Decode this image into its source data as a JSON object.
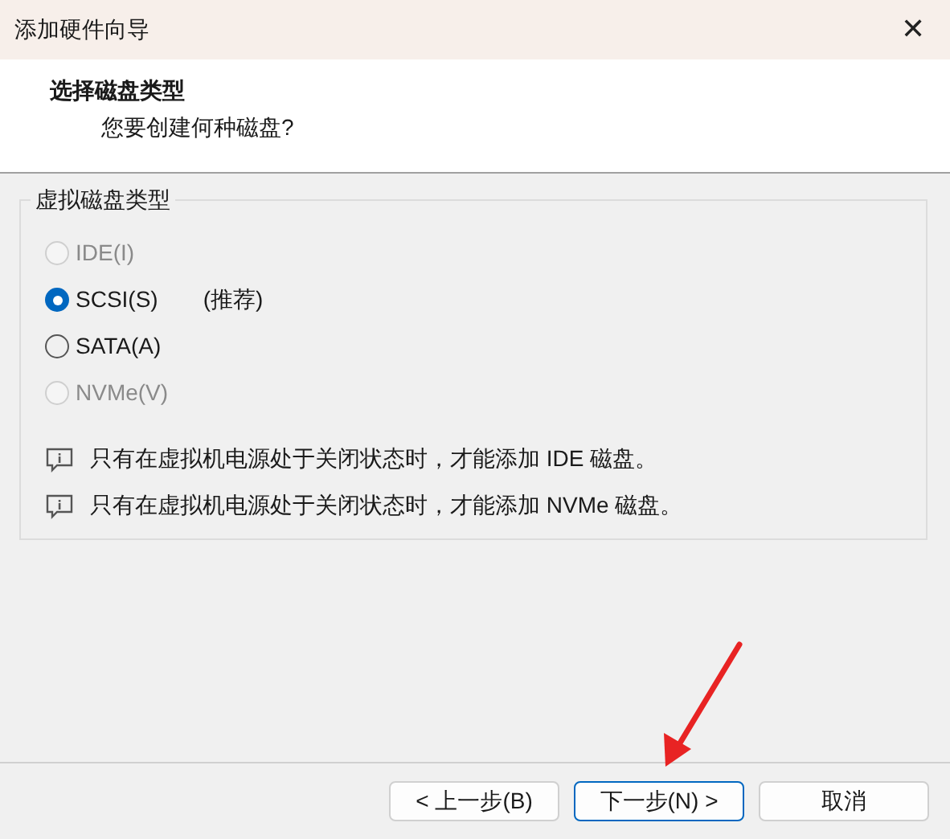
{
  "window": {
    "title": "添加硬件向导",
    "close": "✕"
  },
  "header": {
    "title": "选择磁盘类型",
    "subtitle": "您要创建何种磁盘?"
  },
  "group": {
    "label": "虚拟磁盘类型",
    "options": [
      {
        "label": "IDE(I)",
        "selected": false,
        "disabled": true
      },
      {
        "label": "SCSI(S)",
        "selected": true,
        "disabled": false,
        "note": "(推荐)"
      },
      {
        "label": "SATA(A)",
        "selected": false,
        "disabled": false
      },
      {
        "label": "NVMe(V)",
        "selected": false,
        "disabled": true
      }
    ],
    "notes": [
      "只有在虚拟机电源处于关闭状态时，才能添加 IDE 磁盘。",
      "只有在虚拟机电源处于关闭状态时，才能添加 NVMe 磁盘。"
    ]
  },
  "buttons": [
    {
      "label": "< 上一步(B)",
      "selected": false
    },
    {
      "label": "下一步(N) >",
      "selected": true
    },
    {
      "label": "取消",
      "selected": false
    }
  ]
}
